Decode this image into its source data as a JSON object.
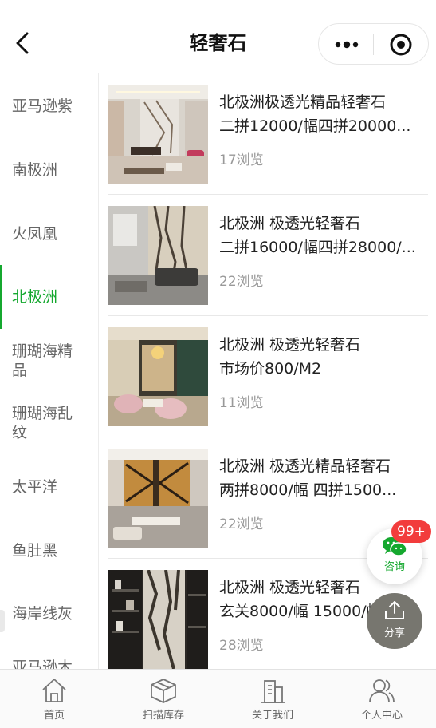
{
  "header": {
    "title": "轻奢石",
    "icons": {
      "back": "back-arrow-icon",
      "more": "more-dots-icon",
      "close": "target-close-icon"
    }
  },
  "sidebar": {
    "items": [
      {
        "label": "亚马逊紫"
      },
      {
        "label": "南极洲"
      },
      {
        "label": "火凤凰"
      },
      {
        "label": "北极洲",
        "active": true
      },
      {
        "label": "珊瑚海精品"
      },
      {
        "label": "珊瑚海乱纹"
      },
      {
        "label": "太平洋"
      },
      {
        "label": "鱼肚黑"
      },
      {
        "label": "海岸线灰"
      },
      {
        "label": "亚马逊木"
      }
    ],
    "active_color": "#15a82f"
  },
  "products": [
    {
      "line1": "北极洲极透光精品轻奢石",
      "line2": "二拼12000/幅四拼20000...",
      "views": "17浏览"
    },
    {
      "line1": "北极洲 极透光轻奢石",
      "line2": "二拼16000/幅四拼28000/...",
      "views": "22浏览"
    },
    {
      "line1": "北极洲 极透光轻奢石",
      "line2": "市场价800/M2",
      "views": "11浏览"
    },
    {
      "line1": "北极洲 极透光精品轻奢石",
      "line2": "两拼8000/幅 四拼1500...",
      "views": "22浏览"
    },
    {
      "line1": "北极洲 极透光轻奢石",
      "line2": "玄关8000/幅 15000/幅...",
      "views": "28浏览"
    }
  ],
  "float": {
    "consult_label": "咨询",
    "badge": "99+",
    "share_label": "分享"
  },
  "tabbar": {
    "tabs": [
      {
        "label": "首页",
        "icon": "home-icon"
      },
      {
        "label": "扫描库存",
        "icon": "box-icon"
      },
      {
        "label": "关于我们",
        "icon": "building-icon"
      },
      {
        "label": "个人中心",
        "icon": "user-icon"
      }
    ]
  },
  "colors": {
    "accent": "#15a82f",
    "badge": "#f23c3c",
    "share_bg": "#77766f"
  }
}
